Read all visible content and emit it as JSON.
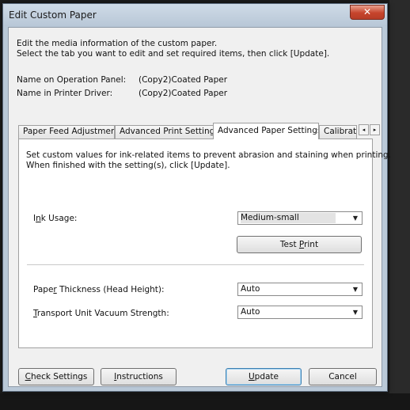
{
  "window": {
    "title": "Edit Custom Paper",
    "close_glyph": "✕"
  },
  "intro": {
    "line1": "Edit the media information of the custom paper.",
    "line2": "Select the tab you want to edit and set required items, then click [Update]."
  },
  "info": {
    "operation_panel_label": "Name on Operation Panel:",
    "operation_panel_value": "(Copy2)Coated Paper",
    "printer_driver_label": "Name in Printer Driver:",
    "printer_driver_value": "(Copy2)Coated Paper"
  },
  "tabs": [
    {
      "label": "Paper Feed Adjustment",
      "active": false
    },
    {
      "label": "Advanced Print Settings",
      "active": false
    },
    {
      "label": "Advanced Paper Settings",
      "active": true
    },
    {
      "label": "Calibrat",
      "active": false
    }
  ],
  "tab_scroll": {
    "left_glyph": "◂",
    "right_glyph": "▸"
  },
  "panel": {
    "desc_line1": "Set custom values for ink-related items to prevent abrasion and staining when printing.",
    "desc_line2": "When finished with the setting(s), click [Update].",
    "ink_usage": {
      "label_pre": "I",
      "label_key": "n",
      "label_post": "k Usage:",
      "value": "Medium-small"
    },
    "test_print": {
      "label_pre": "Test ",
      "label_key": "P",
      "label_post": "rint"
    },
    "paper_thickness": {
      "label_pre": "Pape",
      "label_key": "r",
      "label_post": " Thickness (Head Height):",
      "value": "Auto"
    },
    "vacuum": {
      "label_pre": "",
      "label_key": "T",
      "label_post": "ransport Unit Vacuum Strength:",
      "value": "Auto"
    },
    "dropdown_arrow": "▼"
  },
  "footer": {
    "check_settings": {
      "pre": "",
      "key": "C",
      "post": "heck Settings"
    },
    "instructions": {
      "pre": "",
      "key": "I",
      "post": "nstructions"
    },
    "update": {
      "pre": "",
      "key": "U",
      "post": "pdate"
    },
    "cancel": "Cancel"
  }
}
